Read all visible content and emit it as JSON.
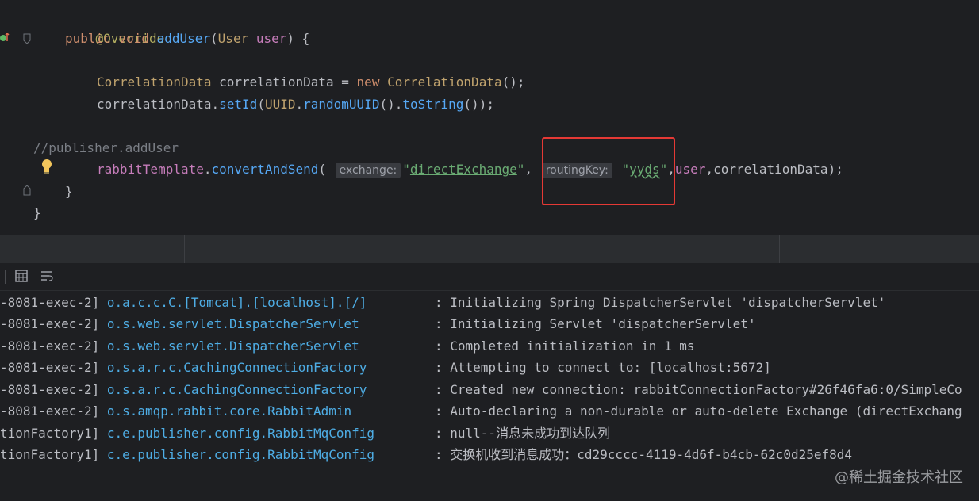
{
  "editor": {
    "annotation": "@Override",
    "method_modifiers": "public void ",
    "method_name": "addUser",
    "param_type": "User",
    "param_name": "user",
    "corr_type": "CorrelationData",
    "corr_var": "correlationData",
    "new_kw": "new",
    "corr_ctor": "CorrelationData",
    "setid_obj": "correlationData",
    "setid_method": "setId",
    "uuid_class": "UUID",
    "uuid_method": "randomUUID",
    "tostring_method": "toString",
    "comment": "//publisher.addUser",
    "template_var": "rabbitTemplate",
    "send_method": "convertAndSend",
    "hint_exchange": "exchange:",
    "exchange_value": "directExchange",
    "hint_routing": "routingKey:",
    "routing_value": "yyds",
    "tail_user": "user",
    "tail_corr": "correlationData"
  },
  "console": {
    "lines": [
      {
        "thread": "-8081-exec-2]",
        "logger": "o.a.c.c.C.[Tomcat].[localhost].[/]",
        "message": ": Initializing Spring DispatcherServlet 'dispatcherServlet'"
      },
      {
        "thread": "-8081-exec-2]",
        "logger": "o.s.web.servlet.DispatcherServlet",
        "message": ": Initializing Servlet 'dispatcherServlet'"
      },
      {
        "thread": "-8081-exec-2]",
        "logger": "o.s.web.servlet.DispatcherServlet",
        "message": ": Completed initialization in 1 ms"
      },
      {
        "thread": "-8081-exec-2]",
        "logger": "o.s.a.r.c.CachingConnectionFactory",
        "message": ": Attempting to connect to: [localhost:5672]"
      },
      {
        "thread": "-8081-exec-2]",
        "logger": "o.s.a.r.c.CachingConnectionFactory",
        "message": ": Created new connection: rabbitConnectionFactory#26f46fa6:0/SimpleCo"
      },
      {
        "thread": "-8081-exec-2]",
        "logger": "o.s.amqp.rabbit.core.RabbitAdmin",
        "message": ": Auto-declaring a non-durable or auto-delete Exchange (directExchang"
      },
      {
        "thread": "tionFactory1]",
        "logger": "c.e.publisher.config.RabbitMqConfig",
        "message": ": null--消息未成功到达队列"
      },
      {
        "thread": "tionFactory1]",
        "logger": "c.e.publisher.config.RabbitMqConfig",
        "message": ": 交换机收到消息成功：cd29cccc-4119-4d6f-b4cb-62c0d25ef8d4"
      }
    ]
  },
  "watermark": "@稀土掘金技术社区",
  "colors": {
    "background": "#1e1f22",
    "logger": "#4eade5",
    "highlight_box": "#e53935"
  }
}
